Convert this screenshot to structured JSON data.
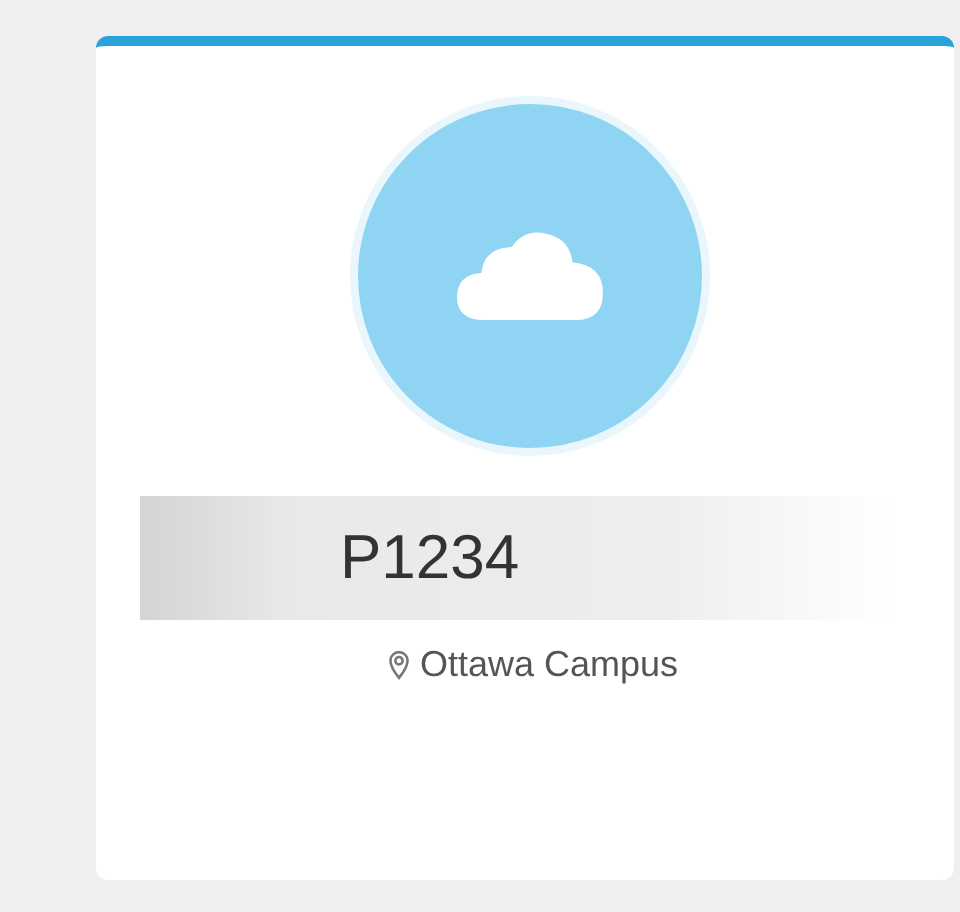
{
  "card": {
    "title": "P1234",
    "location": "Ottawa Campus"
  }
}
